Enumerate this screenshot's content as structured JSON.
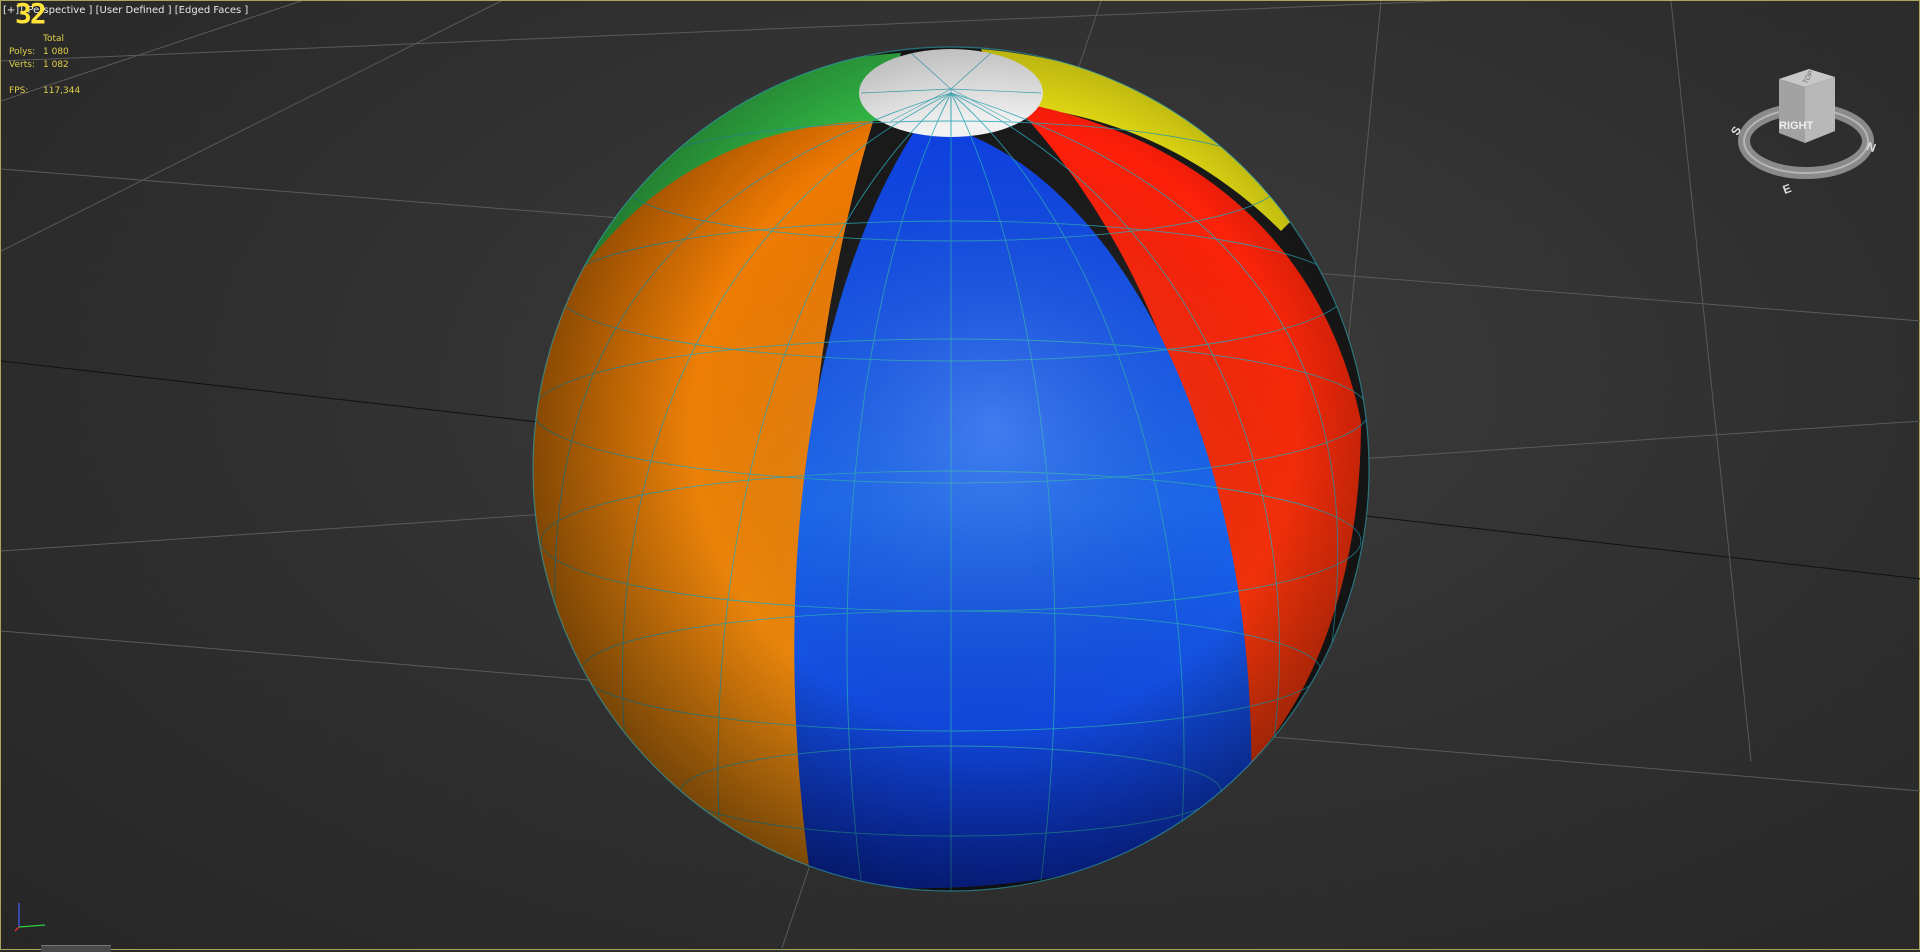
{
  "viewport": {
    "label_prefix": "[+]",
    "label_view": "[ Perspective ]",
    "label_shading": "[User Defined ]",
    "label_edges": "[Edged Faces ]",
    "overlay_number": "32"
  },
  "stats": {
    "header": "Total",
    "polys_label": "Polys:",
    "polys_value": "1 080",
    "verts_label": "Verts:",
    "verts_value": "1 082",
    "fps_label": "FPS:",
    "fps_value": "117,344"
  },
  "viewcube": {
    "face_label": "RIGHT",
    "top_label": "TOP",
    "compass": [
      "S",
      "E",
      "N"
    ]
  },
  "colors": {
    "viewport_border": "#a9a55a",
    "stats_text": "#e0cf4a",
    "wire": "#2aa7b8",
    "panel_blue": "#1357e6",
    "panel_red": "#f21b0c",
    "panel_orange": "#f07a00",
    "panel_green": "#39c24a",
    "panel_yellow": "#e5dc12",
    "panel_white": "#f2f2f2"
  }
}
